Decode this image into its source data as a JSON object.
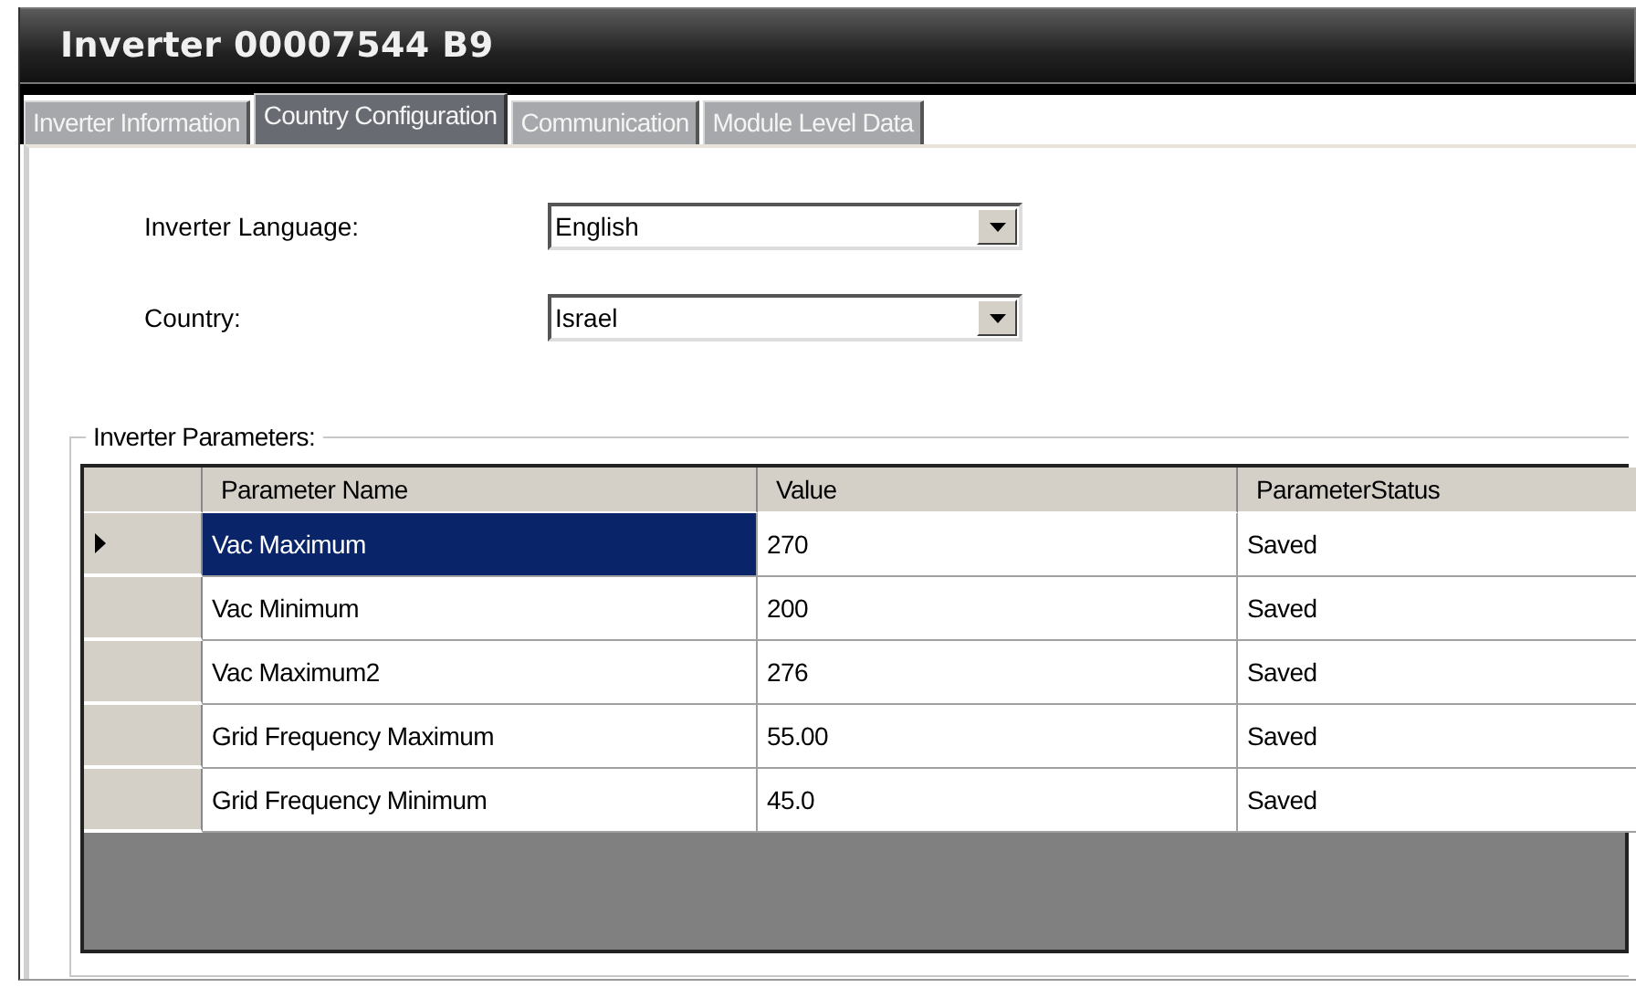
{
  "window": {
    "title": "Inverter 00007544 B9"
  },
  "tabs": [
    {
      "label": "Inverter Information",
      "selected": false
    },
    {
      "label": "Country Configuration",
      "selected": true
    },
    {
      "label": "Communication",
      "selected": false
    },
    {
      "label": "Module Level Data",
      "selected": false
    }
  ],
  "fields": [
    {
      "label": "Inverter Language:",
      "value": "English"
    },
    {
      "label": "Country:",
      "value": "Israel"
    }
  ],
  "parameters": {
    "title": "Inverter Parameters:",
    "columns": [
      "Parameter Name",
      "Value",
      "ParameterStatus"
    ],
    "rows": [
      {
        "cells": [
          "Vac Maximum",
          "270",
          "Saved"
        ],
        "selected": true
      },
      {
        "cells": [
          "Vac Minimum",
          "200",
          "Saved"
        ],
        "selected": false
      },
      {
        "cells": [
          "Vac Maximum2",
          "276",
          "Saved"
        ],
        "selected": false
      },
      {
        "cells": [
          "Grid Frequency Maximum",
          "55.00",
          "Saved"
        ],
        "selected": false
      },
      {
        "cells": [
          "Grid Frequency Minimum",
          "45.0",
          "Saved"
        ],
        "selected": false
      }
    ]
  }
}
